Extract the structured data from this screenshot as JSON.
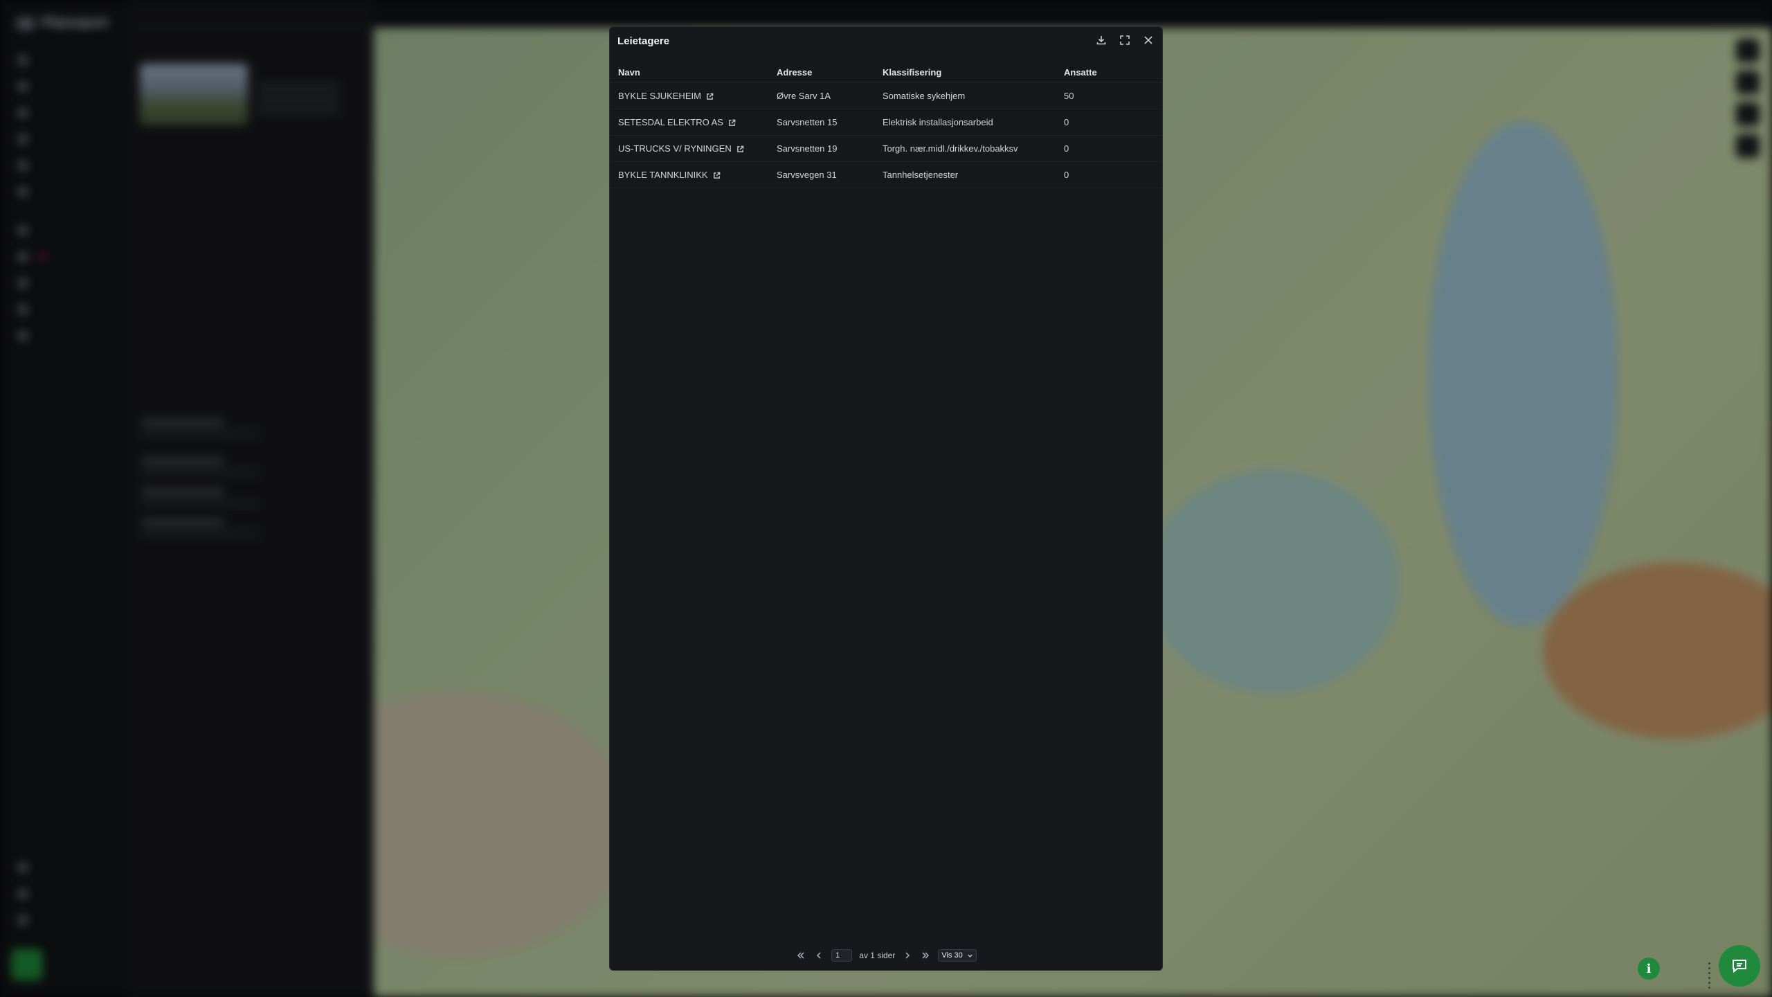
{
  "app": {
    "name": "Plaiceport"
  },
  "modal": {
    "title": "Leietagere",
    "columns": {
      "name": "Navn",
      "address": "Adresse",
      "classification": "Klassifisering",
      "employees": "Ansatte"
    },
    "rows": [
      {
        "name": "BYKLE SJUKEHEIM",
        "address": "Øvre Sarv 1A",
        "classification": "Somatiske sykehjem",
        "employees": "50"
      },
      {
        "name": "SETESDAL ELEKTRO AS",
        "address": "Sarvsnetten 15",
        "classification": "Elektrisk installasjonsarbeid",
        "employees": "0"
      },
      {
        "name": "US-TRUCKS V/ RYNINGEN",
        "address": "Sarvsnetten 19",
        "classification": "Torgh. nær.midl./drikkev./tobakksv",
        "employees": "0"
      },
      {
        "name": "BYKLE TANNKLINIKK",
        "address": "Sarvsvegen 31",
        "classification": "Tannhelsetjenester",
        "employees": "0"
      }
    ],
    "pager": {
      "page": "1",
      "of_label": "av 1 sider",
      "per_page": "Vis 30"
    },
    "icons": [
      "download-icon",
      "expand-icon",
      "close-icon",
      "external-link-icon",
      "first-page-icon",
      "prev-page-icon",
      "next-page-icon",
      "last-page-icon",
      "chevron-down-icon"
    ]
  },
  "colors": {
    "modal_bg": "#17181b",
    "accent_green": "#1f8a3b"
  }
}
